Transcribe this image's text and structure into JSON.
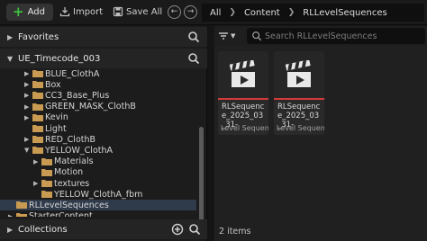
{
  "toolbar": {
    "add_label": "Add",
    "import_label": "Import",
    "saveall_label": "Save All"
  },
  "breadcrumb": {
    "items": [
      "All",
      "Content",
      "RLLevelSequences"
    ]
  },
  "sidebar": {
    "favorites_label": "Favorites",
    "project_label": "UE_Timecode_003",
    "collections_label": "Collections",
    "tree": [
      {
        "label": "BLUE_ClothA",
        "depth": 2,
        "expanded": false,
        "has_children": true,
        "selected": false
      },
      {
        "label": "Box",
        "depth": 2,
        "expanded": false,
        "has_children": true,
        "selected": false
      },
      {
        "label": "CC3_Base_Plus",
        "depth": 2,
        "expanded": false,
        "has_children": true,
        "selected": false
      },
      {
        "label": "GREEN_MASK_ClothB",
        "depth": 2,
        "expanded": false,
        "has_children": true,
        "selected": false
      },
      {
        "label": "Kevin",
        "depth": 2,
        "expanded": false,
        "has_children": true,
        "selected": false
      },
      {
        "label": "Light",
        "depth": 2,
        "expanded": false,
        "has_children": false,
        "selected": false
      },
      {
        "label": "RED_ClothB",
        "depth": 2,
        "expanded": false,
        "has_children": true,
        "selected": false
      },
      {
        "label": "YELLOW_ClothA",
        "depth": 2,
        "expanded": true,
        "has_children": true,
        "selected": false
      },
      {
        "label": "Materials",
        "depth": 3,
        "expanded": false,
        "has_children": true,
        "selected": false
      },
      {
        "label": "Motion",
        "depth": 3,
        "expanded": false,
        "has_children": false,
        "selected": false
      },
      {
        "label": "textures",
        "depth": 3,
        "expanded": false,
        "has_children": true,
        "selected": false
      },
      {
        "label": "YELLOW_ClothA_fbm",
        "depth": 3,
        "expanded": false,
        "has_children": false,
        "selected": false
      },
      {
        "label": "RLLevelSequences",
        "depth": 1,
        "expanded": false,
        "has_children": false,
        "selected": true
      },
      {
        "label": "StarterContent",
        "depth": 1,
        "expanded": false,
        "has_children": true,
        "selected": false
      }
    ]
  },
  "content": {
    "search_placeholder": "Search RLLevelSequences",
    "assets": [
      {
        "name": "RLSequence_2025_03_31-",
        "type": "Level Sequence"
      },
      {
        "name": "RLSequence_2025_03_31-",
        "type": "Level Sequence"
      }
    ],
    "status_text": "2 items"
  },
  "colors": {
    "accent_add": "#3fbf3f",
    "asset_bar": "#d43a3a",
    "folder": "#c99a52",
    "selection": "#2f3a4a"
  }
}
